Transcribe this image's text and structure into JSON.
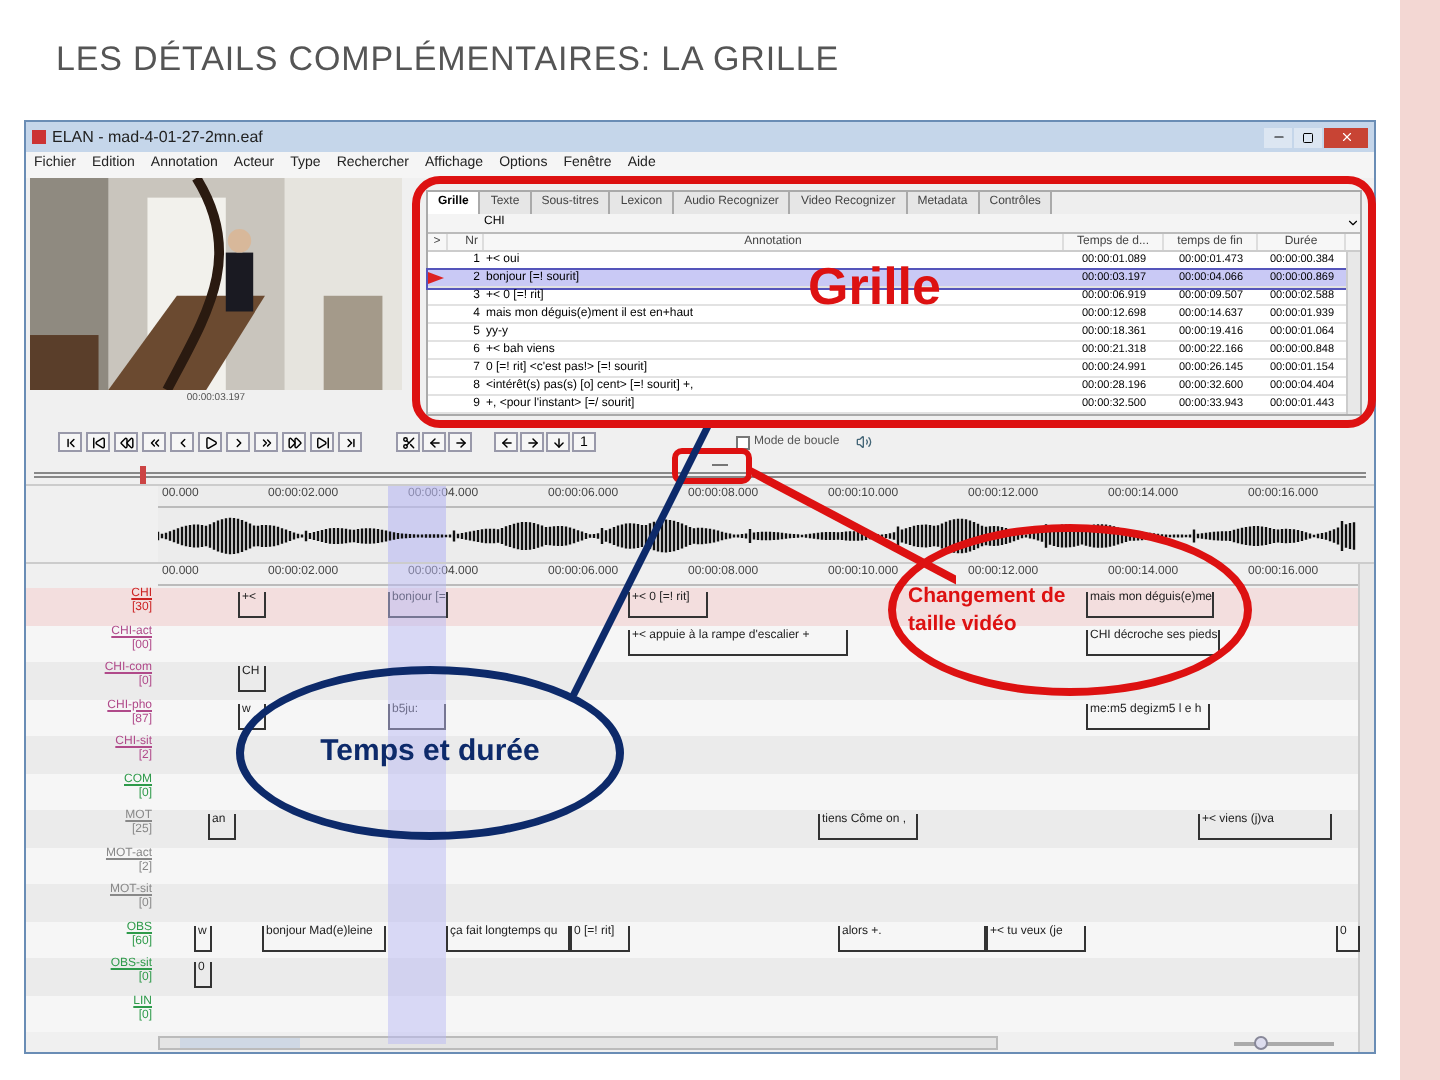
{
  "slide_title": "LES DÉTAILS COMPLÉMENTAIRES: LA GRILLE",
  "window": {
    "title": "ELAN - mad-4-01-27-2mn.eaf"
  },
  "menu": [
    "Fichier",
    "Edition",
    "Annotation",
    "Acteur",
    "Type",
    "Rechercher",
    "Affichage",
    "Options",
    "Fenêtre",
    "Aide"
  ],
  "video": {
    "time": "00:00:03.197"
  },
  "tabs": [
    {
      "label": "Grille",
      "selected": true
    },
    {
      "label": "Texte",
      "selected": false
    },
    {
      "label": "Sous-titres",
      "selected": false
    },
    {
      "label": "Lexicon",
      "selected": false
    },
    {
      "label": "Audio Recognizer",
      "selected": false
    },
    {
      "label": "Video Recognizer",
      "selected": false
    },
    {
      "label": "Metadata",
      "selected": false
    },
    {
      "label": "Contrôles",
      "selected": false
    }
  ],
  "tier_select": {
    "value": "CHI"
  },
  "grid": {
    "columns": [
      ">",
      "Nr",
      "Annotation",
      "Temps de d...",
      "temps de fin",
      "Durée"
    ],
    "rows": [
      {
        "nr": "1",
        "annotation": "+< oui",
        "start": "00:00:01.089",
        "end": "00:00:01.473",
        "duration": "00:00:00.384",
        "selected": false
      },
      {
        "nr": "2",
        "annotation": "bonjour [=! sourit]",
        "start": "00:00:03.197",
        "end": "00:00:04.066",
        "duration": "00:00:00.869",
        "selected": true
      },
      {
        "nr": "3",
        "annotation": "+< 0 [=! rit]",
        "start": "00:00:06.919",
        "end": "00:00:09.507",
        "duration": "00:00:02.588",
        "selected": false
      },
      {
        "nr": "4",
        "annotation": "mais mon déguis(e)ment il est en+haut",
        "start": "00:00:12.698",
        "end": "00:00:14.637",
        "duration": "00:00:01.939",
        "selected": false
      },
      {
        "nr": "5",
        "annotation": "yy-y",
        "start": "00:00:18.361",
        "end": "00:00:19.416",
        "duration": "00:00:01.064",
        "selected": false
      },
      {
        "nr": "6",
        "annotation": "+< bah viens",
        "start": "00:00:21.318",
        "end": "00:00:22.166",
        "duration": "00:00:00.848",
        "selected": false
      },
      {
        "nr": "7",
        "annotation": "0 [=! rit] <c'est pas!> [=! sourit]",
        "start": "00:00:24.991",
        "end": "00:00:26.145",
        "duration": "00:00:01.154",
        "selected": false
      },
      {
        "nr": "8",
        "annotation": "<intérêt(s) pas(s) [o] cent> [=! sourit] +,",
        "start": "00:00:28.196",
        "end": "00:00:32.600",
        "duration": "00:00:04.404",
        "selected": false
      },
      {
        "nr": "9",
        "annotation": "+, <pour l'instant> [=/ sourit]",
        "start": "00:00:32.500",
        "end": "00:00:33.943",
        "duration": "00:00:01.443",
        "selected": false
      }
    ]
  },
  "controls": {
    "jump_label": "1",
    "loop": {
      "label": "Mode de boucle",
      "checked": false
    }
  },
  "overview": {
    "level": 0.08
  },
  "wave_ruler": [
    "00.000",
    "00:00:02.000",
    "00:00:04.000",
    "00:00:06.000",
    "00:00:08.000",
    "00:00:10.000",
    "00:00:12.000",
    "00:00:14.000",
    "00:00:16.000"
  ],
  "tier_ruler": [
    "00.000",
    "00:00:02.000",
    "00:00:04.000",
    "00:00:06.000",
    "00:00:08.000",
    "00:00:10.000",
    "00:00:12.000",
    "00:00:14.000",
    "00:00:16.000"
  ],
  "tiers": [
    {
      "name": "CHI",
      "count": "[30]",
      "color": "#cc2222",
      "annotations": [
        "+<",
        "bonjour [=",
        "+< 0 [=! rit]",
        "mais mon déguis(e)me"
      ]
    },
    {
      "name": "CHI-act",
      "count": "[00]",
      "color": "#b04a8a",
      "annotations": [
        "+< appuie à la rampe d'escalier +",
        "CHI décroche ses pieds"
      ]
    },
    {
      "name": "CHI-com",
      "count": "[0]",
      "color": "#b04a8a",
      "annotations": [
        "CH"
      ]
    },
    {
      "name": "CHI-pho",
      "count": "[87]",
      "color": "#b04a8a",
      "annotations": [
        "w",
        "b5ju:",
        "me:m5 degizm5 l e h"
      ]
    },
    {
      "name": "CHI-sit",
      "count": "[2]",
      "color": "#b04a8a"
    },
    {
      "name": "COM",
      "count": "[0]",
      "color": "#2e9a4a"
    },
    {
      "name": "MOT",
      "count": "[25]",
      "color": "#888888",
      "annotations": [
        "an",
        "tiens Côme on ,",
        "+< viens (j)va"
      ]
    },
    {
      "name": "MOT-act",
      "count": "[2]",
      "color": "#888888"
    },
    {
      "name": "MOT-sit",
      "count": "[0]",
      "color": "#888888"
    },
    {
      "name": "OBS",
      "count": "[60]",
      "color": "#2e9a4a",
      "annotations": [
        "w",
        "bonjour Mad(e)leine",
        "ça fait longtemps qu",
        "0 [=! rit]",
        "alors +.",
        "+< tu veux (je",
        "0"
      ]
    },
    {
      "name": "OBS-sit",
      "count": "[0]",
      "color": "#2e9a4a",
      "annotations": [
        "0"
      ]
    },
    {
      "name": "LIN",
      "count": "[0]",
      "color": "#2e9a4a"
    }
  ],
  "zoom_slider": {
    "level": 0.2
  },
  "callouts": [
    {
      "text": "Grille",
      "color": "#dd1111"
    },
    {
      "text": "Changement de taille vidéo",
      "color": "#dd1111"
    },
    {
      "text": "Temps et durée",
      "color": "#0d2a6a"
    }
  ]
}
